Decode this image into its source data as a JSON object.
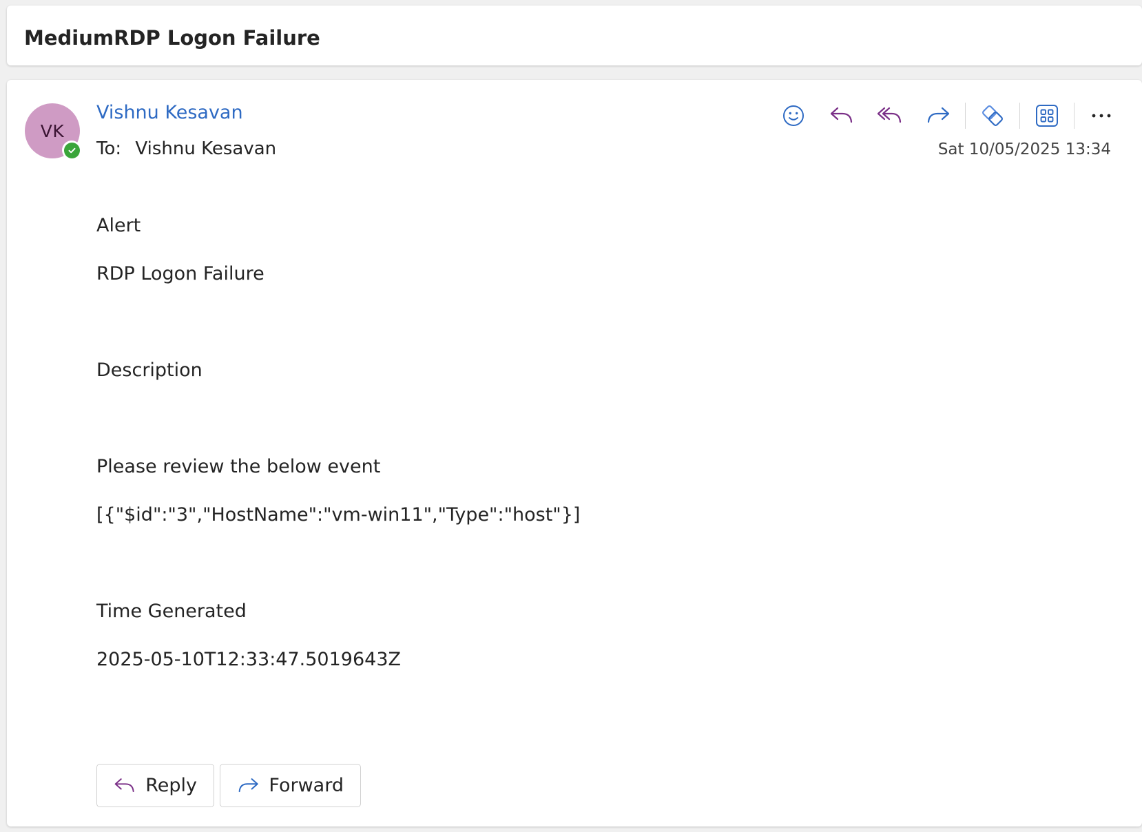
{
  "subject": {
    "title": "MediumRDP Logon Failure"
  },
  "message": {
    "sender": {
      "name": "Vishnu Kesavan",
      "initials": "VK",
      "avatar_color": "#cf9bc4",
      "presence": "available"
    },
    "to_label": "To:",
    "recipient": "Vishnu Kesavan",
    "timestamp": "Sat 10/05/2025 13:34",
    "toolbar": [
      {
        "name": "emoji-icon"
      },
      {
        "name": "reply-icon"
      },
      {
        "name": "reply-all-icon"
      },
      {
        "name": "forward-icon"
      },
      {
        "name": "viva-icon"
      },
      {
        "name": "apps-icon"
      },
      {
        "name": "more-icon"
      }
    ],
    "body": {
      "heading_alert": "Alert",
      "alert_name": "RDP Logon Failure",
      "heading_description": "Description",
      "description_text": "Please review the below event",
      "entity_json": "[{\"$id\":\"3\",\"HostName\":\"vm-win11\",\"Type\":\"host\"}]",
      "heading_time": "Time Generated",
      "time_value": "2025-05-10T12:33:47.5019643Z"
    },
    "actions": {
      "reply_label": "Reply",
      "forward_label": "Forward"
    }
  },
  "colors": {
    "sender_link": "#2e6ac3",
    "reply_purple": "#7a2f87",
    "forward_blue": "#2e6ac3",
    "presence_green": "#3aa53a"
  }
}
